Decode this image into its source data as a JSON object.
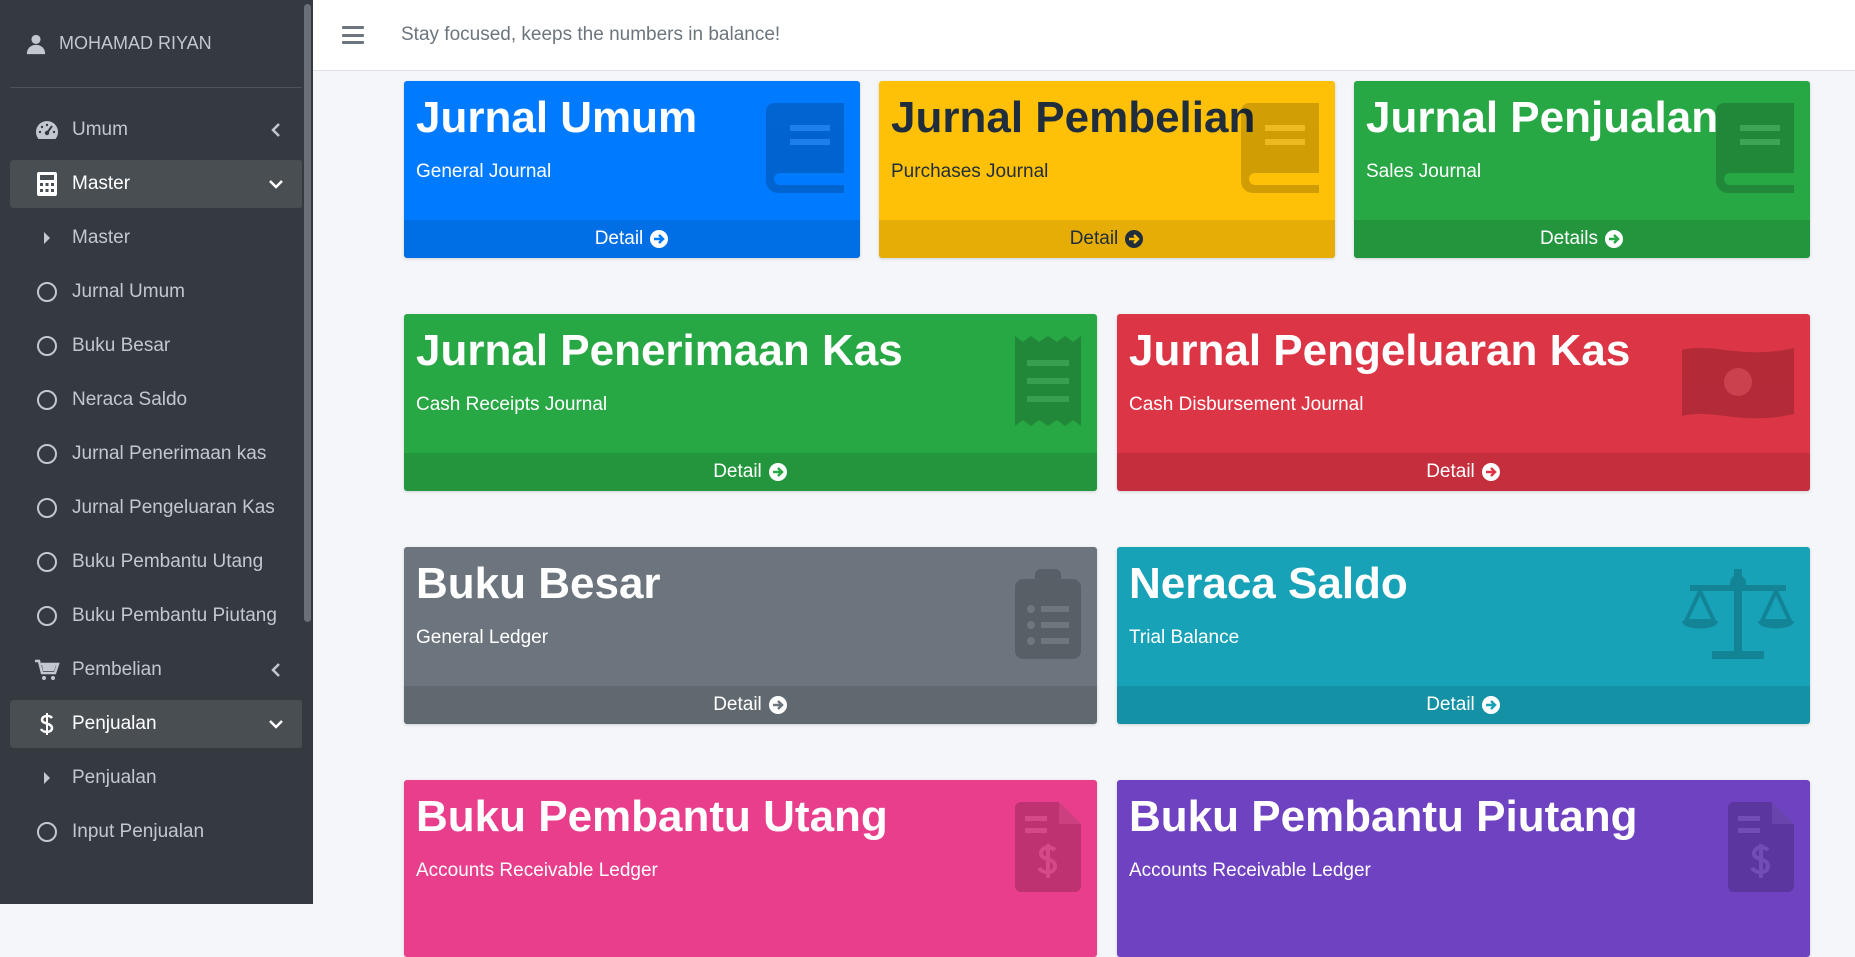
{
  "sidebar": {
    "user_name": "MOHAMAD RIYAN",
    "items": [
      {
        "label": "Umum",
        "icon": "tachometer-icon"
      },
      {
        "label": "Master",
        "icon": "calculator-icon"
      },
      {
        "label": "Master",
        "icon": "caret-right-icon"
      },
      {
        "label": "Jurnal Umum",
        "icon": "circle-icon"
      },
      {
        "label": "Buku Besar",
        "icon": "circle-icon"
      },
      {
        "label": "Neraca Saldo",
        "icon": "circle-icon"
      },
      {
        "label": "Jurnal Penerimaan kas",
        "icon": "circle-icon"
      },
      {
        "label": "Jurnal Pengeluaran Kas",
        "icon": "circle-icon"
      },
      {
        "label": "Buku Pembantu Utang",
        "icon": "circle-icon"
      },
      {
        "label": "Buku Pembantu Piutang",
        "icon": "circle-icon"
      },
      {
        "label": "Pembelian",
        "icon": "cart-icon"
      },
      {
        "label": "Penjualan",
        "icon": "dollar-icon"
      },
      {
        "label": "Penjualan",
        "icon": "caret-right-icon"
      },
      {
        "label": "Input Penjualan",
        "icon": "circle-icon"
      }
    ]
  },
  "header": {
    "tagline": "Stay focused, keeps the numbers in balance!"
  },
  "cards": [
    {
      "title": "Jurnal Umum",
      "subtitle": "General Journal",
      "footer": "Detail",
      "color": "#007bff",
      "icon": "book-icon"
    },
    {
      "title": "Jurnal Pembelian",
      "subtitle": "Purchases Journal",
      "footer": "Detail",
      "color": "#ffc107",
      "icon": "book-icon"
    },
    {
      "title": "Jurnal Penjualan",
      "subtitle": "Sales Journal",
      "footer": "Details",
      "color": "#28a745",
      "icon": "book-icon"
    },
    {
      "title": "Jurnal Penerimaan Kas",
      "subtitle": "Cash Receipts Journal",
      "footer": "Detail",
      "color": "#28a745",
      "icon": "receipt-icon"
    },
    {
      "title": "Jurnal Pengeluaran Kas",
      "subtitle": "Cash Disbursement Journal",
      "footer": "Detail",
      "color": "#dc3545",
      "icon": "money-bill-icon"
    },
    {
      "title": "Buku Besar",
      "subtitle": "General Ledger",
      "footer": "Detail",
      "color": "#6c757d",
      "icon": "clipboard-list-icon"
    },
    {
      "title": "Neraca Saldo",
      "subtitle": "Trial Balance",
      "footer": "Detail",
      "color": "#17a2b8",
      "icon": "balance-scale-icon"
    },
    {
      "title": "Buku Pembantu Utang",
      "subtitle": "Accounts Receivable Ledger",
      "footer": "",
      "color": "#e83e8c",
      "icon": "file-invoice-dollar-icon"
    },
    {
      "title": "Buku Pembantu Piutang",
      "subtitle": "Accounts Receivable Ledger",
      "footer": "",
      "color": "#6f42c1",
      "icon": "file-invoice-dollar-icon"
    }
  ]
}
